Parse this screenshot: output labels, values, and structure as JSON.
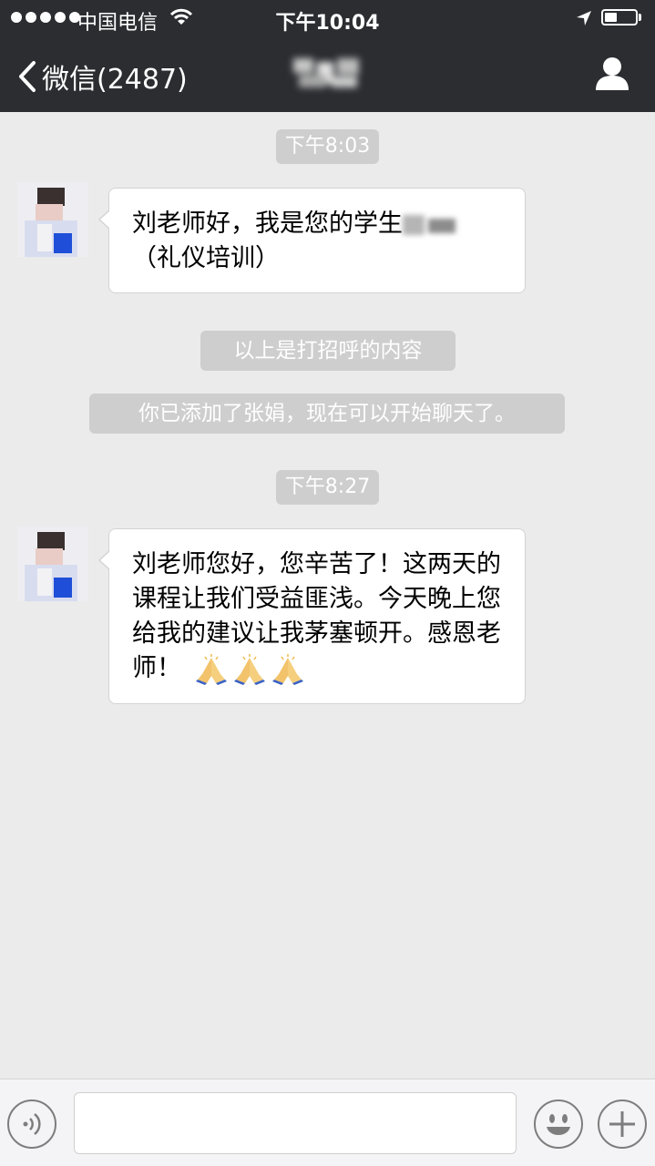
{
  "status_bar": {
    "carrier": "中国电信",
    "time": "下午10:04",
    "signal_bars": 5,
    "battery_level": 0.4
  },
  "nav": {
    "back_label": "微信(2487)",
    "back_icon": "chevron-left-icon",
    "profile_icon": "person-icon"
  },
  "messages": [
    {
      "type": "time",
      "text": "下午8:03"
    },
    {
      "type": "received",
      "text": "刘老师好，我是您的学生",
      "text_after": "（礼仪培训）"
    },
    {
      "type": "system",
      "text": "以上是打招呼的内容"
    },
    {
      "type": "system",
      "text": "你已添加了张娟，现在可以开始聊天了。"
    },
    {
      "type": "time",
      "text": "下午8:27"
    },
    {
      "type": "received",
      "text": "刘老师您好，您辛苦了！这两天的课程让我们受益匪浅。今天晚上您给我的建议让我茅塞顿开。感恩老师！",
      "emoji": [
        "folded-hands",
        "folded-hands",
        "folded-hands"
      ]
    }
  ],
  "input_bar": {
    "value": "",
    "voice_icon": "voice-icon",
    "emoji_icon": "smiley-icon",
    "more_icon": "plus-icon"
  },
  "colors": {
    "nav_bg": "#2b2d31",
    "chat_bg": "#ebebeb",
    "pill_bg": "#cecece",
    "bubble_bg": "#ffffff"
  }
}
